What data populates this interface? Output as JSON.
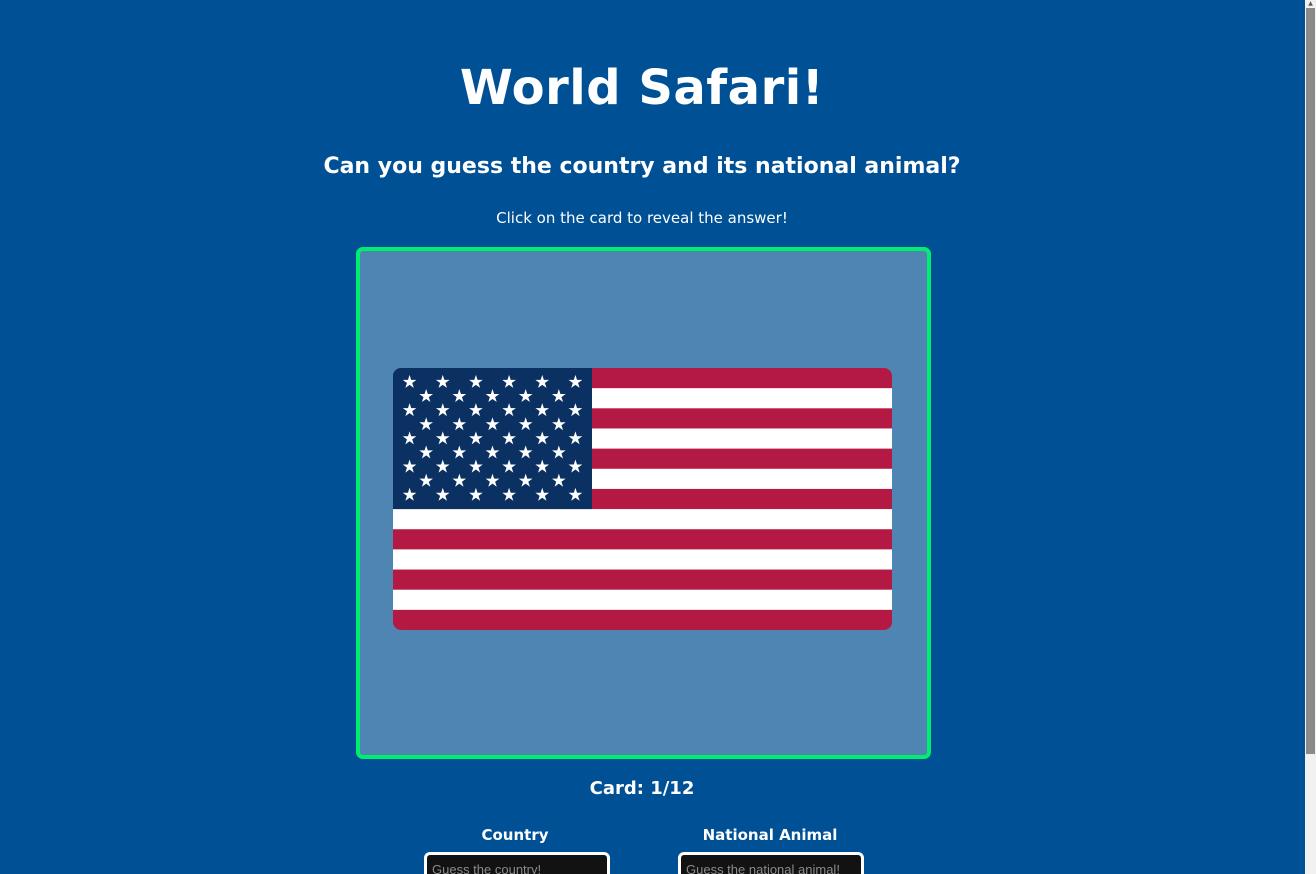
{
  "header": {
    "title": "World Safari!",
    "subtitle": "Can you guess the country and its national animal?",
    "instructions": "Click on the card to reveal the answer!"
  },
  "card": {
    "image_icon": "flag-united-states",
    "flag_colors": {
      "red": "#b31942",
      "white": "#ffffff",
      "blue": "#0a3161"
    }
  },
  "counter": {
    "label": "Card: 1/12"
  },
  "guess_form": {
    "country_label": "Country",
    "country_placeholder": "Guess the country!",
    "country_value": "",
    "animal_label": "National Animal",
    "animal_placeholder": "Guess the national animal!",
    "animal_value": ""
  },
  "colors": {
    "background": "#005096",
    "card_background": "#4f85b2",
    "card_border": "#00ee6e"
  }
}
